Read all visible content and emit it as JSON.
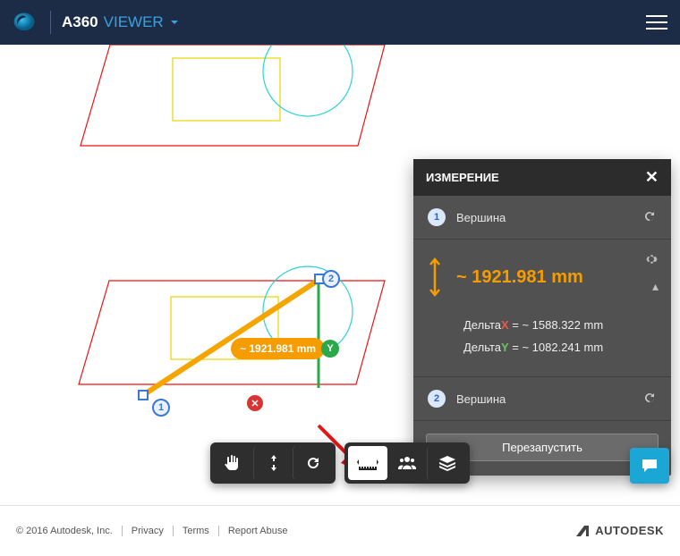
{
  "header": {
    "product": "A360",
    "mode": "VIEWER"
  },
  "canvas": {
    "measure_label": "~ 1921.981 mm",
    "y_marker": "Y",
    "x_marker": "✕",
    "point1": "1",
    "point2": "2"
  },
  "panel": {
    "title": "ИЗМЕРЕНИЕ",
    "rows": {
      "p1_num": "1",
      "p1_label": "Вершина",
      "p2_num": "2",
      "p2_label": "Вершина"
    },
    "distance": "~ 1921.981 mm",
    "delta_x_label": "Дельта",
    "delta_x_axis": "X",
    "delta_x_value": " = ~ 1588.322 mm",
    "delta_y_label": "Дельта",
    "delta_y_axis": "Y",
    "delta_y_value": " = ~ 1082.241 mm",
    "restart": "Перезапустить"
  },
  "footer": {
    "copyright": "© 2016 Autodesk, Inc.",
    "privacy": "Privacy",
    "terms": "Terms",
    "report": "Report Abuse",
    "brand": "AUTODESK"
  }
}
